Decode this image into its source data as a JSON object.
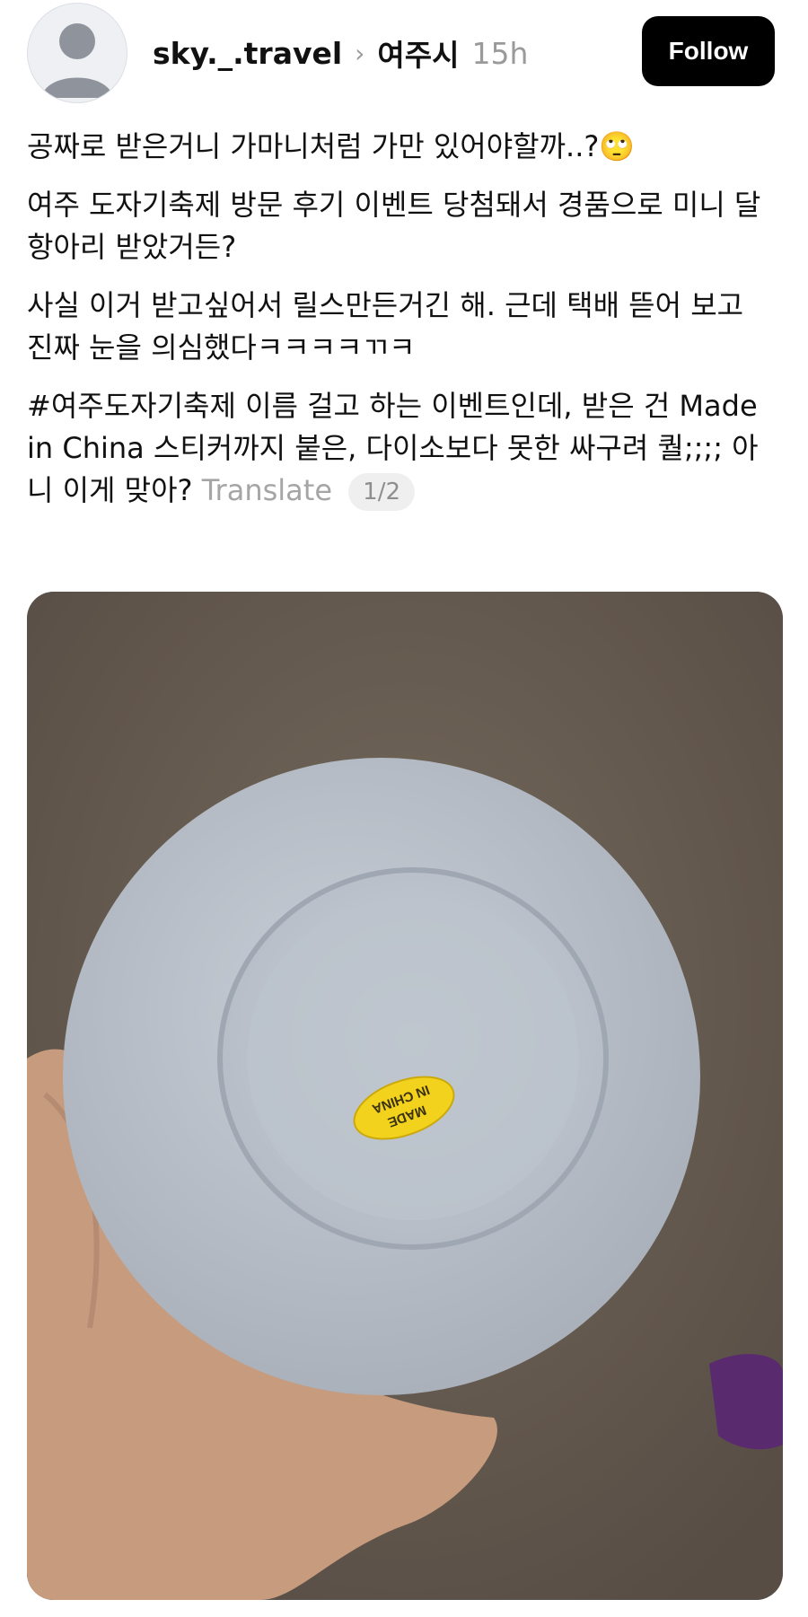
{
  "header": {
    "username": "sky._.travel",
    "separator_icon": "chevron-right-icon",
    "location": "여주시",
    "time": "15h",
    "follow_label": "Follow"
  },
  "post": {
    "lines": [
      "공짜로 받은거니 가마니처럼 가만 있어야할까..?🙄",
      "여주 도자기축제 방문 후기 이벤트 당첨돼서 경품으로 미니 달항아리 받았거든?",
      "사실 이거 받고싶어서 릴스만든거긴 해. 근데 택배 뜯어 보고 진짜 눈을 의심했다ㅋㅋㅋㅋㄲㅋ",
      "#여주도자기축제 이름 걸고 하는 이벤트인데, 받은 건 Made in China 스티커까지 붙은, 다이소보다 못한 싸구려 퀄;;;; 아니 이게 맞아?"
    ],
    "translate_label": "Translate",
    "page_indicator": "1/2"
  },
  "photo": {
    "sticker_text_line1": "MADE",
    "sticker_text_line2": "IN CHINA",
    "colors": {
      "background": "#6f645a",
      "bowl": "#b8bfc9",
      "sticker": "#f2d21c"
    }
  }
}
